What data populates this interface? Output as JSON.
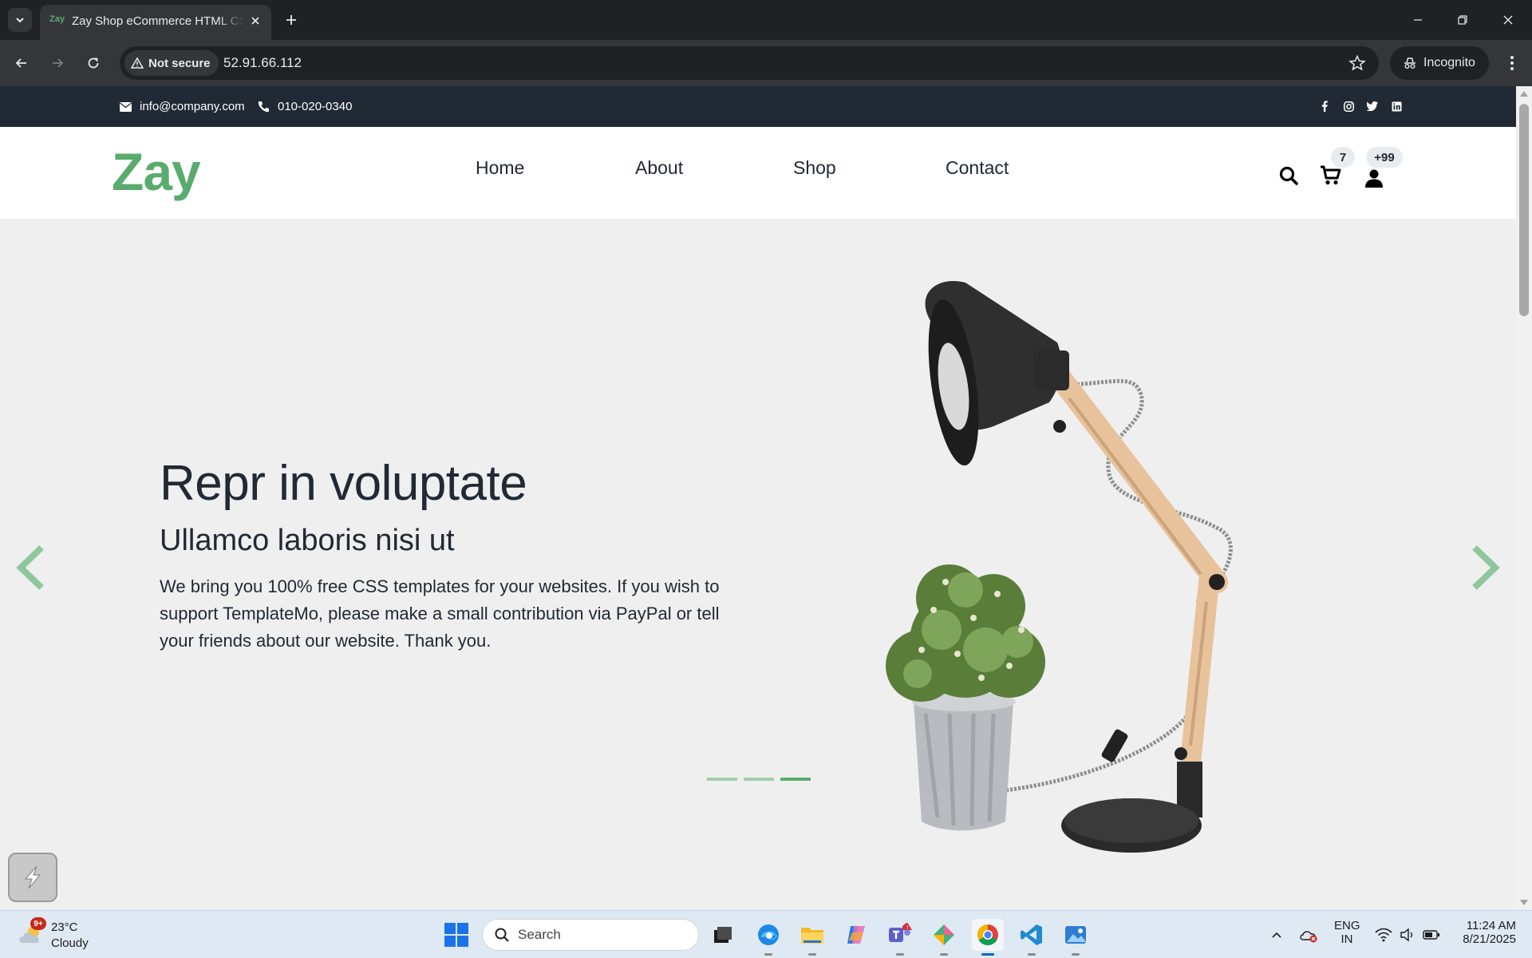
{
  "browser": {
    "tab_title": "Zay Shop eCommerce HTML CSS Template",
    "tab_favicon_text": "Zay",
    "security_label": "Not secure",
    "url": "52.91.66.112",
    "incognito_label": "Incognito"
  },
  "topbar": {
    "email": "info@company.com",
    "phone": "010-020-0340",
    "socials": [
      "facebook-icon",
      "instagram-icon",
      "twitter-icon",
      "linkedin-icon"
    ]
  },
  "header": {
    "logo": "Zay",
    "nav": [
      "Home",
      "About",
      "Shop",
      "Contact"
    ],
    "cart_count": "7",
    "user_count": "+99"
  },
  "hero": {
    "title": "Repr in voluptate",
    "subtitle": "Ullamco laboris nisi ut",
    "text": "We bring you 100% free CSS templates for your websites. If you wish to support TemplateMo, please make a small contribution via PayPal or tell your friends about our website. Thank you.",
    "slides": 3,
    "active_slide": 3
  },
  "colors": {
    "brand_green": "#59ab6e",
    "topbar_dark": "#212934",
    "hero_bg": "#efefef"
  },
  "taskbar": {
    "weather_temp": "23°C",
    "weather_cond": "Cloudy",
    "weather_badge": "9+",
    "search_placeholder": "Search",
    "lang_line1": "ENG",
    "lang_line2": "IN",
    "time": "11:24 AM",
    "date": "8/21/2025",
    "apps": [
      "task-view",
      "edge",
      "file-explorer",
      "copilot",
      "teams",
      "app-gem",
      "chrome",
      "vscode",
      "photos"
    ]
  }
}
